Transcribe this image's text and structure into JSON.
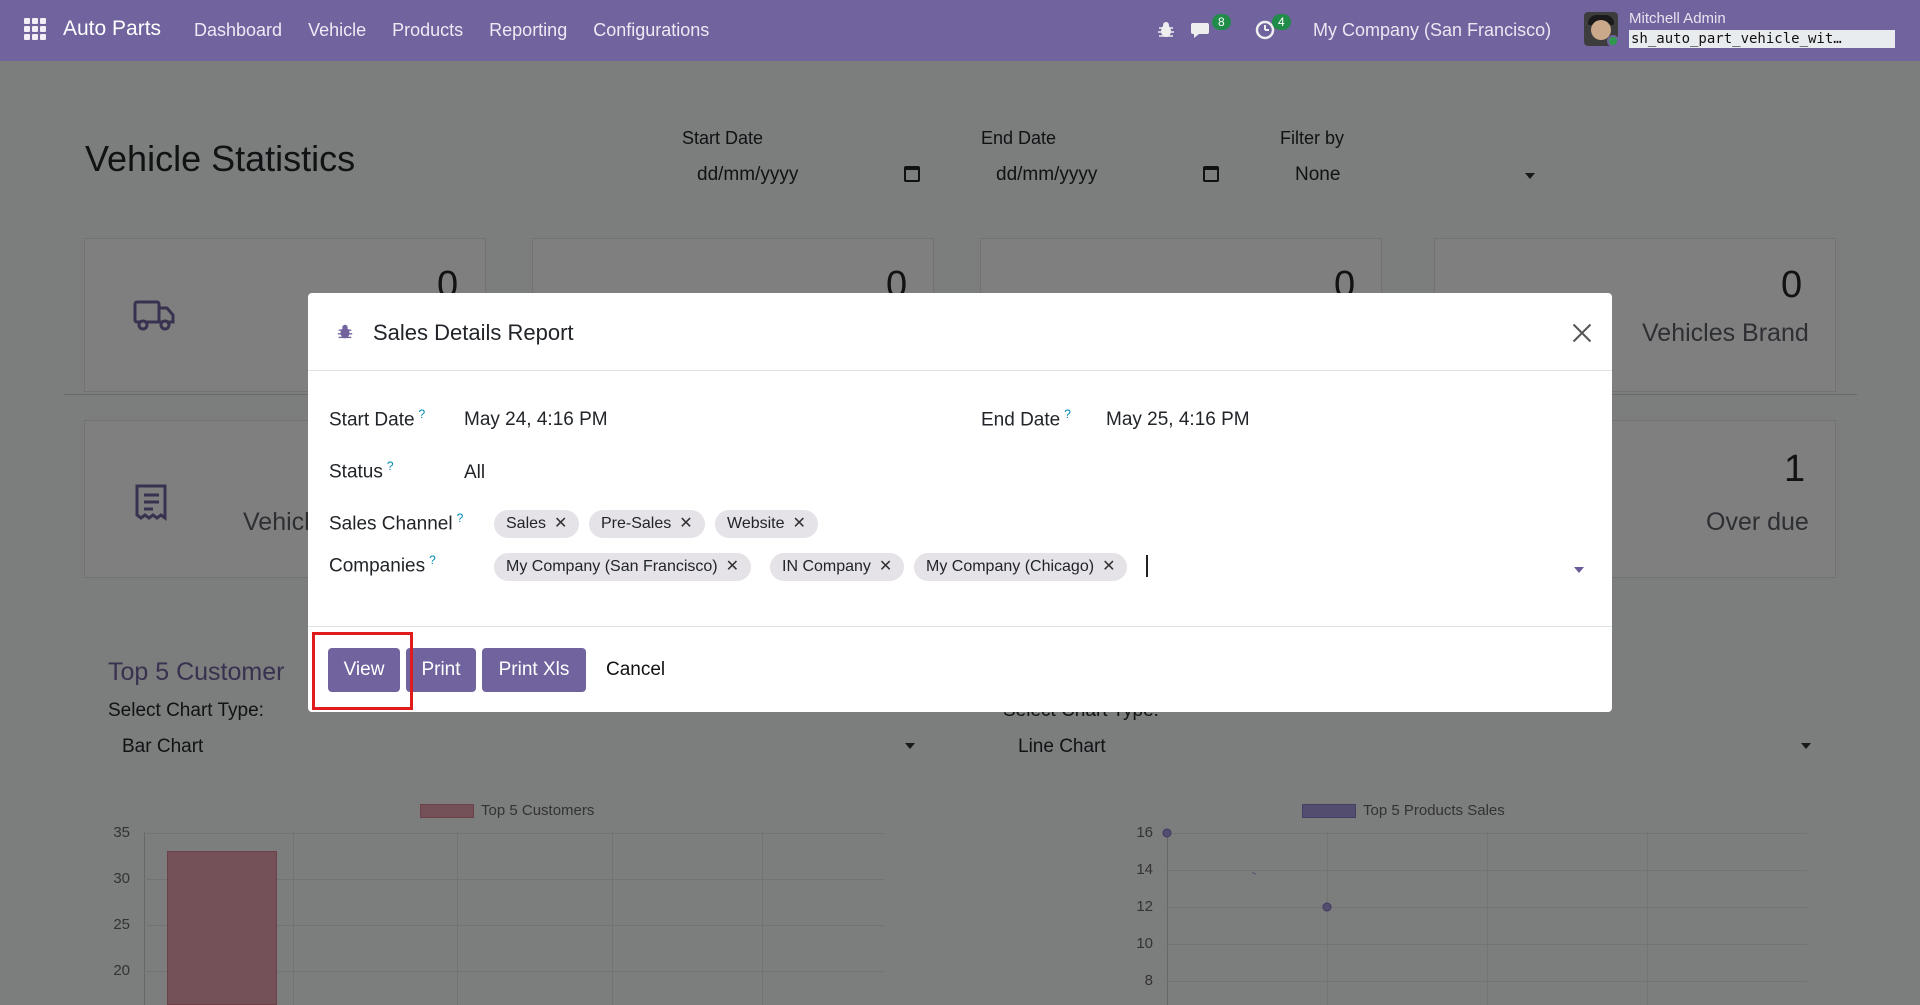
{
  "navbar": {
    "brand": "Auto Parts",
    "menu": [
      "Dashboard",
      "Vehicle",
      "Products",
      "Reporting",
      "Configurations"
    ],
    "messages_count": "8",
    "activities_count": "4",
    "company": "My Company (San Francisco)",
    "user_name": "Mitchell Admin",
    "database": "sh_auto_part_vehicle_wit…"
  },
  "page": {
    "title": "Vehicle Statistics",
    "start_date_label": "Start Date",
    "start_date_value": "dd/mm/yyyy",
    "end_date_label": "End Date",
    "end_date_value": "dd/mm/yyyy",
    "filter_label": "Filter by",
    "filter_value": "None",
    "stats_row1": [
      "0",
      "0",
      "0",
      "0"
    ],
    "stat_brand_label": "Vehicles Brand",
    "stat_row2_partial": "Vehicl",
    "stat_overdue_value": "1",
    "stat_overdue_label": "Over due",
    "top_customer_title": "Top 5 Customer",
    "select_chart_label": "Select Chart Type:",
    "select_chart_label_partial": "Select Chart Type:",
    "left_chart_type": "Bar Chart",
    "right_chart_type": "Line Chart"
  },
  "chart_data": [
    {
      "type": "bar",
      "series": [
        {
          "name": "Top 5 Customers",
          "values": [
            33
          ]
        }
      ],
      "yticks": [
        "35",
        "30",
        "25",
        "20"
      ],
      "color": "#e8a3b1"
    },
    {
      "type": "line",
      "series": [
        {
          "name": "Top 5 Products Sales",
          "values": [
            16,
            12
          ]
        }
      ],
      "yticks": [
        "16",
        "14",
        "12",
        "10",
        "8"
      ],
      "color": "#a79be0"
    }
  ],
  "dialog": {
    "title": "Sales Details Report",
    "start_date_label": "Start Date",
    "start_date_value": "May 24, 4:16 PM",
    "end_date_label": "End Date",
    "end_date_value": "May 25, 4:16 PM",
    "status_label": "Status",
    "status_value": "All",
    "channel_label": "Sales Channel",
    "channels": [
      "Sales",
      "Pre-Sales",
      "Website"
    ],
    "companies_label": "Companies",
    "companies": [
      "My Company (San Francisco)",
      "IN Company",
      "My Company (Chicago)"
    ],
    "help_mark": "?",
    "remove_mark": "✕",
    "btn_view": "View",
    "btn_print": "Print",
    "btn_print_xls": "Print Xls",
    "btn_cancel": "Cancel"
  }
}
